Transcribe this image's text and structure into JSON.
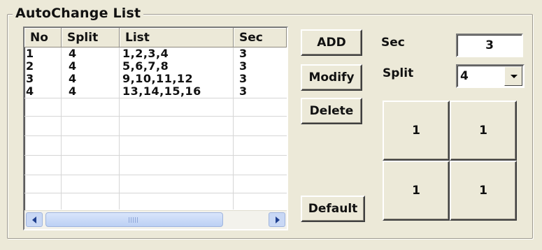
{
  "group": {
    "title": "AutoChange List"
  },
  "list": {
    "columns": [
      "No",
      "Split",
      "List",
      "Sec"
    ],
    "rows": [
      [
        "1",
        "4",
        "1,2,3,4",
        "3"
      ],
      [
        "2",
        "4",
        "5,6,7,8",
        "3"
      ],
      [
        "3",
        "4",
        "9,10,11,12",
        "3"
      ],
      [
        "4",
        "4",
        "13,14,15,16",
        "3"
      ]
    ]
  },
  "buttons": {
    "add": "ADD",
    "modify": "Modify",
    "delete": "Delete",
    "default": "Default"
  },
  "sec": {
    "label": "Sec",
    "value": "3"
  },
  "split": {
    "label": "Split",
    "value": "4"
  },
  "preview_grid": [
    "1",
    "1",
    "1",
    "1"
  ],
  "colors": {
    "dialog_bg": "#ece9d8",
    "scrollbar_thumb": "#c9d8f5",
    "scrollbar_arrow": "#1f3f8f"
  },
  "icons": {
    "scroll_left": "chevron-left-icon",
    "scroll_right": "chevron-right-icon",
    "dropdown": "chevron-down-icon"
  }
}
